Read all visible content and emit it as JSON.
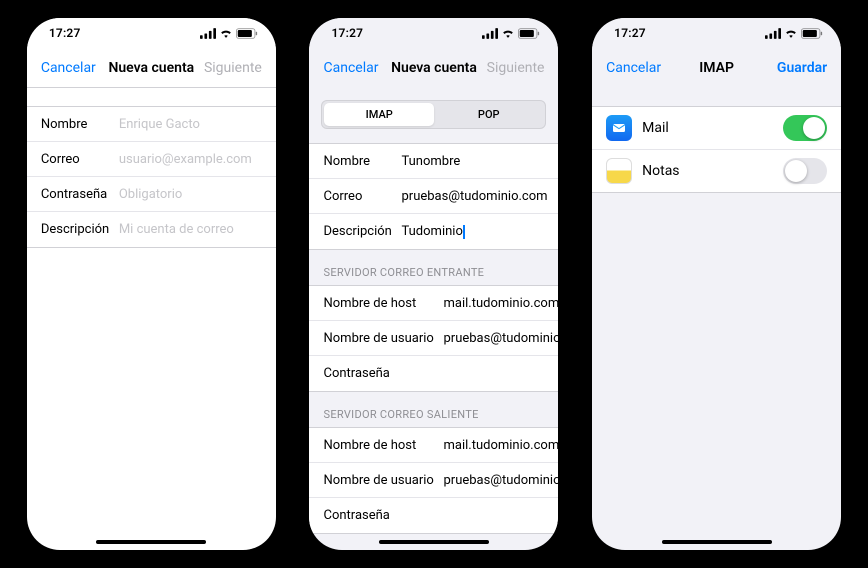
{
  "status": {
    "time": "17:27"
  },
  "screen1": {
    "nav": {
      "left": "Cancelar",
      "title": "Nueva cuenta",
      "right": "Siguiente"
    },
    "fields": {
      "name_label": "Nombre",
      "name_ph": "Enrique Gacto",
      "email_label": "Correo",
      "email_ph": "usuario@example.com",
      "pwd_label": "Contraseña",
      "pwd_ph": "Obligatorio",
      "desc_label": "Descripción",
      "desc_ph": "Mi cuenta de correo"
    }
  },
  "screen2": {
    "nav": {
      "left": "Cancelar",
      "title": "Nueva cuenta",
      "right": "Siguiente"
    },
    "segmented": {
      "imap": "IMAP",
      "pop": "POP"
    },
    "basic": {
      "name_label": "Nombre",
      "name_val": "Tunombre",
      "email_label": "Correo",
      "email_val": "pruebas@tudominio.com",
      "desc_label": "Descripción",
      "desc_val": "Tudominio"
    },
    "incoming": {
      "header": "SERVIDOR CORREO ENTRANTE",
      "host_label": "Nombre de host",
      "host_val": "mail.tudominio.com",
      "user_label": "Nombre de usuario",
      "user_val": "pruebas@tudominio.com",
      "pwd_label": "Contraseña"
    },
    "outgoing": {
      "header": "SERVIDOR CORREO SALIENTE",
      "host_label": "Nombre de host",
      "host_val": "mail.tudominio.com",
      "user_label": "Nombre de usuario",
      "user_val": "pruebas@tudominio.com",
      "pwd_label": "Contraseña"
    }
  },
  "screen3": {
    "nav": {
      "left": "Cancelar",
      "title": "IMAP",
      "right": "Guardar"
    },
    "services": {
      "mail": "Mail",
      "notes": "Notas"
    }
  }
}
